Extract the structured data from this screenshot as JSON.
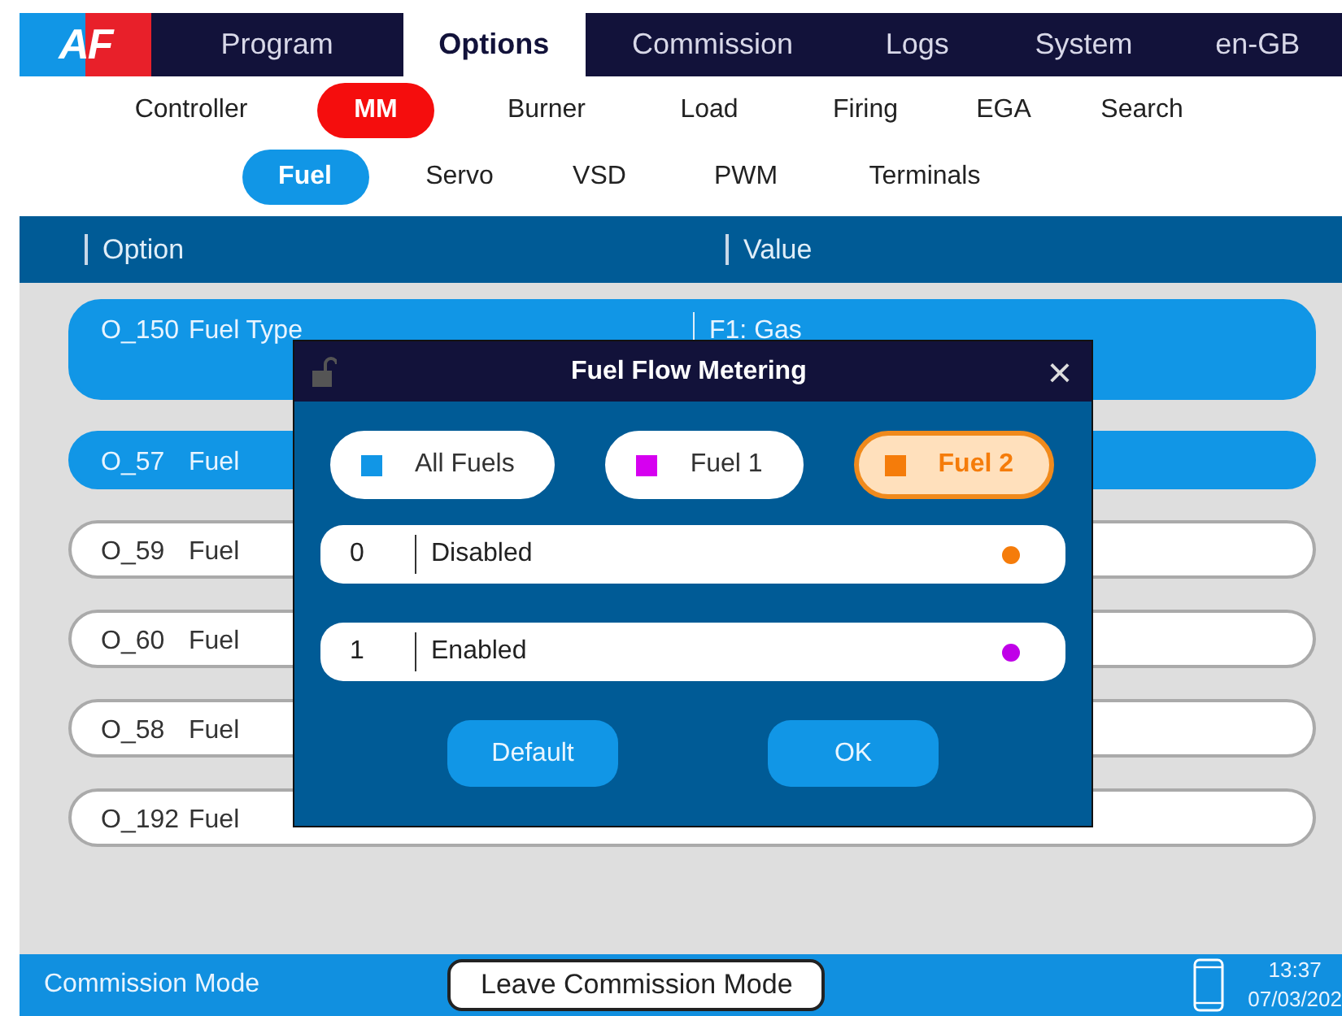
{
  "logo": {
    "text": "AF"
  },
  "main_tabs": [
    {
      "label": "Program",
      "selected": false
    },
    {
      "label": "Options",
      "selected": true
    },
    {
      "label": "Commission",
      "selected": false
    },
    {
      "label": "Logs",
      "selected": false
    },
    {
      "label": "System",
      "selected": false
    },
    {
      "label": "en-GB",
      "selected": false
    }
  ],
  "sub_tabs": [
    {
      "label": "Controller",
      "selected": false
    },
    {
      "label": "MM",
      "selected": true
    },
    {
      "label": "Burner",
      "selected": false
    },
    {
      "label": "Load",
      "selected": false
    },
    {
      "label": "Firing",
      "selected": false
    },
    {
      "label": "EGA",
      "selected": false
    },
    {
      "label": "Search",
      "selected": false
    }
  ],
  "section_tabs": [
    {
      "label": "Fuel",
      "selected": true
    },
    {
      "label": "Servo",
      "selected": false
    },
    {
      "label": "VSD",
      "selected": false
    },
    {
      "label": "PWM",
      "selected": false
    },
    {
      "label": "Terminals",
      "selected": false
    }
  ],
  "table": {
    "columns": [
      "Option",
      "Value"
    ],
    "rows": [
      {
        "id": "O_150",
        "name": "Fuel Type",
        "value": "F1: Gas",
        "selected": true,
        "tall": true
      },
      {
        "id": "O_57",
        "name": "Fuel",
        "selected": true
      },
      {
        "id": "O_59",
        "name": "Fuel",
        "selected": false
      },
      {
        "id": "O_60",
        "name": "Fuel",
        "selected": false
      },
      {
        "id": "O_58",
        "name": "Fuel",
        "selected": false
      },
      {
        "id": "O_192",
        "name": "Fuel",
        "selected": false
      }
    ]
  },
  "dialog": {
    "title": "Fuel Flow Metering",
    "close": "×",
    "fuels": [
      {
        "label": "All Fuels",
        "color": "#1196e6",
        "selected": false
      },
      {
        "label": "Fuel 1",
        "color": "#d600f0",
        "selected": false
      },
      {
        "label": "Fuel 2",
        "color": "#f57c0a",
        "selected": true
      }
    ],
    "choices": [
      {
        "value": "0",
        "label": "Disabled",
        "color": "#f57c0a"
      },
      {
        "value": "1",
        "label": "Enabled",
        "color": "#c000e8"
      }
    ],
    "buttons": [
      "Default",
      "OK"
    ]
  },
  "status_bar": {
    "mode": "Commission Mode",
    "button": "Leave Commission Mode",
    "time": "13:37",
    "date": "07/03/202"
  }
}
